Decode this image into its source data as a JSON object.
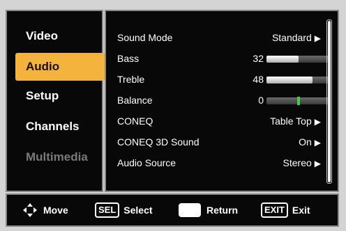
{
  "sidebar": {
    "items": [
      {
        "label": "Video",
        "state": "normal"
      },
      {
        "label": "Audio",
        "state": "active"
      },
      {
        "label": "Setup",
        "state": "normal"
      },
      {
        "label": "Channels",
        "state": "normal"
      },
      {
        "label": "Multimedia",
        "state": "disabled"
      }
    ]
  },
  "audio": {
    "sound_mode": {
      "label": "Sound Mode",
      "value": "Standard"
    },
    "bass": {
      "label": "Bass",
      "value": "32",
      "level": 0.5
    },
    "treble": {
      "label": "Treble",
      "value": "48",
      "level": 0.72
    },
    "balance": {
      "label": "Balance",
      "value": "0",
      "level": 0.5
    },
    "coneq": {
      "label": "CONEQ",
      "value": "Table Top"
    },
    "coneq3d": {
      "label": "CONEQ 3D Sound",
      "value": "On"
    },
    "audio_source": {
      "label": "Audio Source",
      "value": "Stereo"
    }
  },
  "footer": {
    "move_label": "Move",
    "sel_key": "SEL",
    "select_label": "Select",
    "return_label": "Return",
    "exit_key": "EXIT",
    "exit_label": "Exit"
  },
  "colors": {
    "accent": "#f3b33d",
    "balance_marker": "#3fcf3f",
    "panel_bg": "#080808"
  }
}
